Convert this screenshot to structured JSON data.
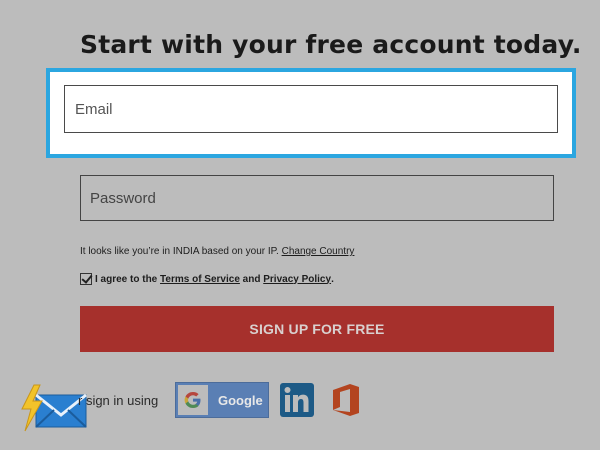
{
  "heading": "Start with your free account today.",
  "email": {
    "placeholder": "Email"
  },
  "password": {
    "placeholder": "Password"
  },
  "ip_notice": {
    "text": "It looks like you’re in INDIA based on your IP.",
    "link": "Change Country"
  },
  "agree": {
    "prefix": "I agree to the",
    "terms": "Terms of Service",
    "and": "and",
    "privacy": "Privacy Policy",
    "suffix": "."
  },
  "signup_label": "SIGN UP FOR FREE",
  "social": {
    "or_label": "r sign in using",
    "google_label": "Google",
    "icons": [
      "google-icon",
      "linkedin-icon",
      "office-icon"
    ]
  },
  "colors": {
    "accent_blue": "#2ba6e0",
    "signup_red": "#a6302c",
    "background": "#bcbcbc"
  }
}
